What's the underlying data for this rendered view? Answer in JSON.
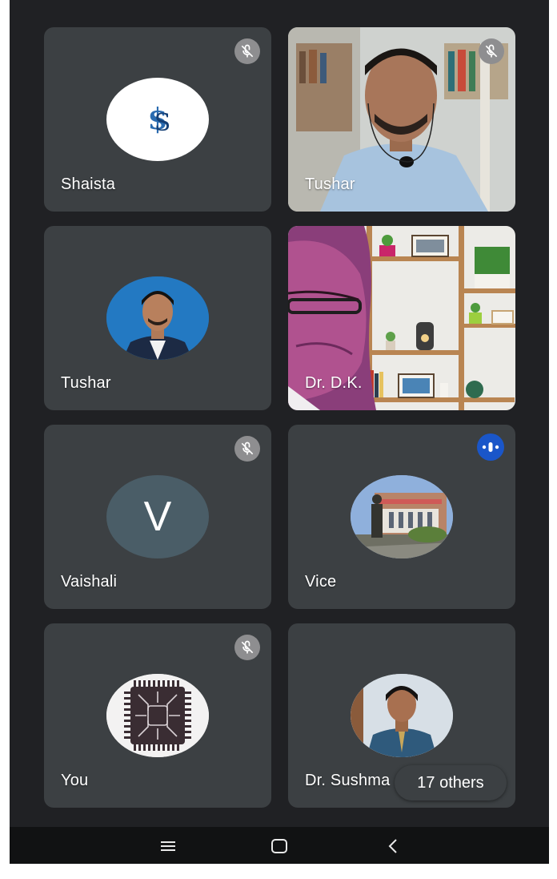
{
  "participants": [
    {
      "name": "Shaista",
      "muted": true
    },
    {
      "name": "Tushar",
      "muted": true
    },
    {
      "name": "Tushar",
      "muted": false
    },
    {
      "name": "Dr. D.K.",
      "muted": false
    },
    {
      "name": "Vaishali",
      "muted": true,
      "avatar_letter": "V"
    },
    {
      "name": "Vice",
      "muted": false,
      "speaking": true
    },
    {
      "name": "You",
      "muted": true
    },
    {
      "name": "Dr. Sushma",
      "muted": false
    }
  ],
  "others": {
    "label": "17 others"
  },
  "colors": {
    "background": "#202124",
    "tile": "#3c4043",
    "mute_badge": "#8e8e90",
    "speaking_badge": "#1a56c9",
    "letter_avatar": "#4a5d67"
  },
  "navbar": {
    "icons": [
      "menu-icon",
      "home-icon",
      "back-icon"
    ]
  }
}
